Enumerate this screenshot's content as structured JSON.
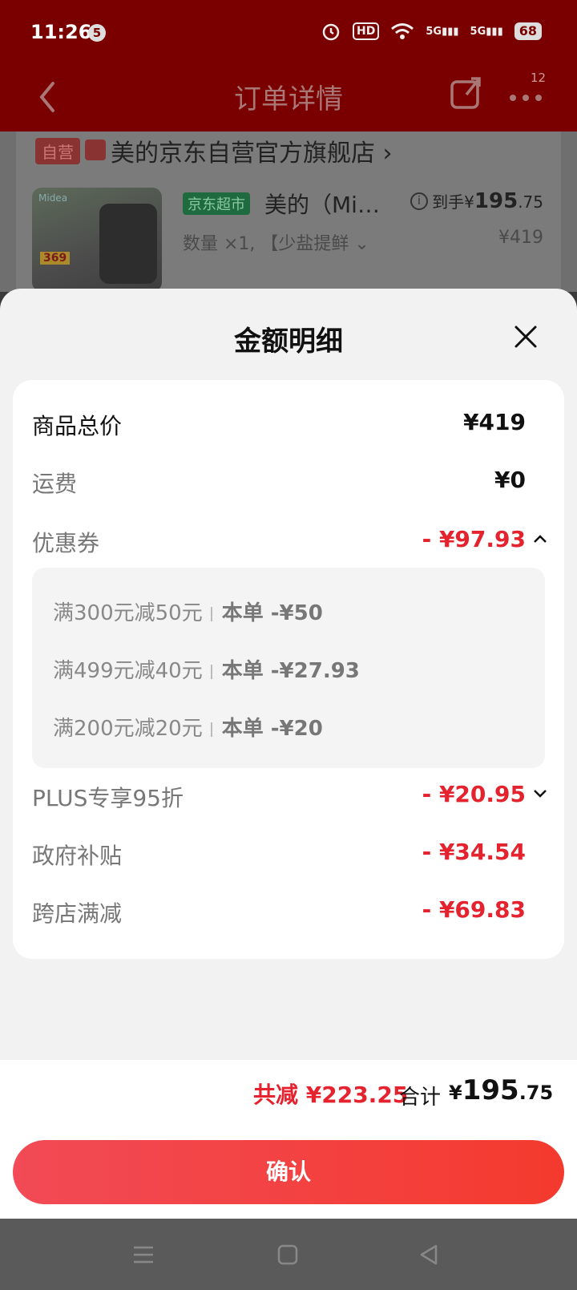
{
  "status_bar": {
    "time": "11:26",
    "notification_count": "5",
    "hd_label": "HD",
    "net_1": "5G",
    "net_2": "5G",
    "battery": "68"
  },
  "nav": {
    "title": "订单详情",
    "more_count": "12"
  },
  "order": {
    "self_operated_tag": "自营",
    "shop_name": "美的京东自营官方旗舰店 ›",
    "product_image_brand": "Midea",
    "product_image_price": "369",
    "supermarket_tag": "京东超市",
    "product_name": "美的（Mi…",
    "final_price_prefix": "到手¥",
    "final_price_int": "195",
    "final_price_dec": ".75",
    "quantity_text": "数量 ×1, 【少盐提鲜 ⌄",
    "original_price": "¥419"
  },
  "sheet": {
    "title": "金额明细",
    "rows": {
      "goods_total": {
        "label": "商品总价",
        "value": "¥419"
      },
      "shipping": {
        "label": "运费",
        "value": "¥0"
      },
      "coupon": {
        "label": "优惠券",
        "value": "- ¥97.93"
      },
      "plus": {
        "label": "PLUS专享95折",
        "value": "- ¥20.95"
      },
      "gov_subsidy": {
        "label": "政府补贴",
        "value": "- ¥34.54"
      },
      "cross_store": {
        "label": "跨店满减",
        "value": "- ¥69.83"
      }
    },
    "coupons": [
      {
        "rule": "满300元减50元",
        "amount": "本单 -¥50"
      },
      {
        "rule": "满499元减40元",
        "amount": "本单 -¥27.93"
      },
      {
        "rule": "满200元减20元",
        "amount": "本单 -¥20"
      }
    ]
  },
  "summary": {
    "total_reduced": "共减 ¥223.25",
    "total_label": "合计",
    "total_currency": "¥",
    "total_int": "195",
    "total_dec": ".75"
  },
  "confirm_label": "确认",
  "colors": {
    "accent_red": "#e4232e",
    "header_bg": "#7a0000",
    "button_gradient_start": "#f24a56",
    "button_gradient_end": "#f43a2e"
  },
  "icons": [
    "back-arrow-icon",
    "share-icon",
    "more-icon",
    "info-icon",
    "close-icon",
    "chevron-up-icon",
    "chevron-down-icon",
    "menu-icon",
    "home-icon",
    "back-triangle-icon"
  ]
}
